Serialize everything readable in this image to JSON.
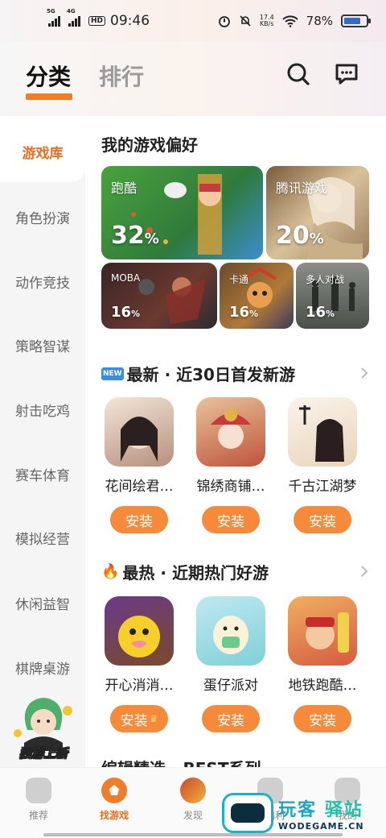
{
  "status_bar": {
    "net1": "5G",
    "net2": "4G",
    "hd": "HD",
    "time": "09:46",
    "speed_value": "17.4",
    "speed_unit": "KB/s",
    "battery_text": "78%",
    "battery_level": 0.78
  },
  "header": {
    "tabs": [
      "分类",
      "排行"
    ],
    "active_tab": 0,
    "icons": [
      "search-icon",
      "message-icon"
    ]
  },
  "sidebar": {
    "items": [
      "游戏库",
      "角色扮演",
      "动作竞技",
      "策略智谋",
      "射击吃鸡",
      "赛车体育",
      "模拟经营",
      "休闲益智",
      "棋牌桌游"
    ],
    "active_index": 0,
    "promo_text": "独游上新"
  },
  "preferences": {
    "title": "我的游戏偏好",
    "cards": [
      {
        "label": "跑酷",
        "percent": "32",
        "unit": "%",
        "color": "#3a8f3a"
      },
      {
        "label": "腾讯游戏",
        "percent": "20",
        "unit": "%",
        "color": "#b79a6a"
      },
      {
        "label": "MOBA",
        "percent": "16",
        "unit": "%",
        "color": "#4a2d2a"
      },
      {
        "label": "卡通",
        "percent": "16",
        "unit": "%",
        "color": "#6a5030"
      },
      {
        "label": "多人对战",
        "percent": "16",
        "unit": "%",
        "color": "#5a6258"
      }
    ]
  },
  "new_section": {
    "badge": "NEW",
    "title": "最新 · 近30日首发新游",
    "apps": [
      {
        "name": "花间绘君…",
        "button": "安装",
        "color": "#b88f7c"
      },
      {
        "name": "锦绣商铺…",
        "button": "安装",
        "color": "#c0533c"
      },
      {
        "name": "千古江湖梦",
        "button": "安装",
        "color": "#f0e4d4"
      }
    ]
  },
  "hot_section": {
    "emoji": "🔥",
    "title": "最热 · 近期热门好游",
    "apps": [
      {
        "name": "开心消消…",
        "button": "安装",
        "crown": "♛",
        "color": "#7a4a2a"
      },
      {
        "name": "蛋仔派对",
        "button": "安装",
        "color": "#7fd0d8"
      },
      {
        "name": "地铁跑酷…",
        "button": "安装",
        "color": "#d55a40"
      }
    ]
  },
  "peek_section": {
    "title": "编辑精选 · BEST系列"
  },
  "bottom_nav": {
    "items": [
      "推荐",
      "找游戏",
      "发现",
      "领福利",
      "我的"
    ],
    "active_index": 1
  },
  "watermark": {
    "line1a": "玩客",
    "line1b": "驿站",
    "line2": "WODEGAME.CN"
  }
}
